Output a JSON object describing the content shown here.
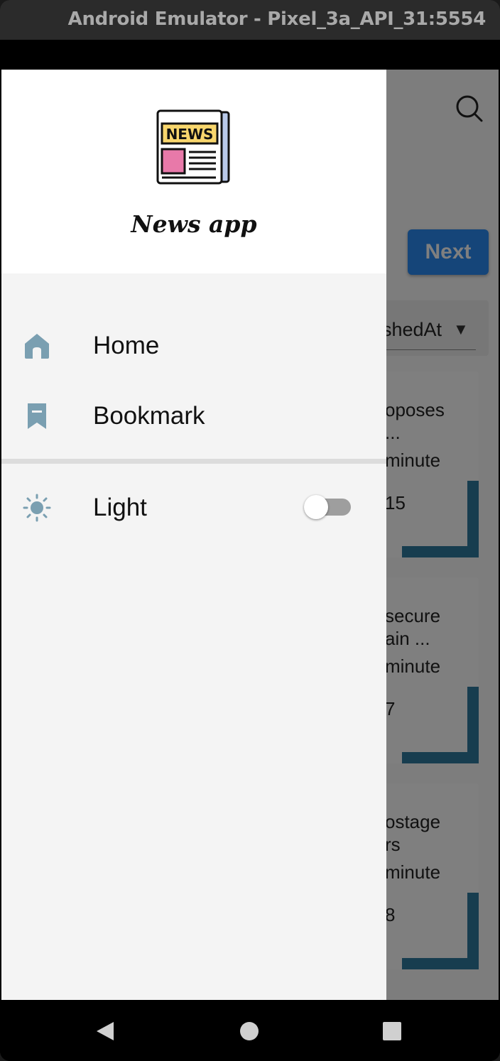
{
  "window": {
    "title": "Android Emulator - Pixel_3a_API_31:5554"
  },
  "background_app": {
    "search_icon": "search-icon",
    "next_label": "Next",
    "sort_label": "shedAt",
    "cards": [
      {
        "title": "oposes\n...",
        "meta": "minute",
        "number": "15"
      },
      {
        "title": "secure\nain ...",
        "meta": "minute",
        "number": "7"
      },
      {
        "title": "ostage\nrs",
        "meta": "minute",
        "number": "8"
      }
    ],
    "accent_color": "#2a8bf2"
  },
  "drawer": {
    "app_name": "News app",
    "logo_text": "NEWS",
    "items": [
      {
        "label": "Home",
        "icon": "home-icon"
      },
      {
        "label": "Bookmark",
        "icon": "bookmark-icon"
      }
    ],
    "theme": {
      "label": "Light",
      "icon": "sun-icon",
      "enabled": false
    },
    "icon_color": "#7a9fb1"
  },
  "navbar": {
    "icons": [
      "back-icon",
      "home-circle-icon",
      "recents-icon"
    ]
  }
}
